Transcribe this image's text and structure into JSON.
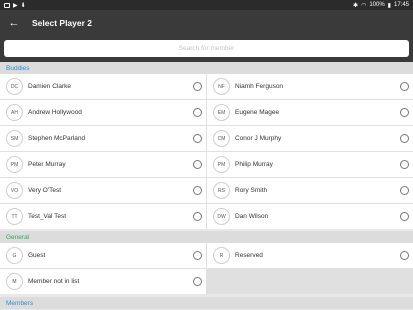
{
  "status_bar": {
    "battery": "100%",
    "time": "17:45"
  },
  "app_bar": {
    "title": "Select Player 2"
  },
  "search": {
    "placeholder": "Search for member"
  },
  "sections": {
    "buddies": "Buddies",
    "general": "General",
    "members": "Members"
  },
  "buddies": [
    {
      "initials": "DC",
      "name": "Damien Clarke"
    },
    {
      "initials": "NF",
      "name": "Niamh Ferguson"
    },
    {
      "initials": "AH",
      "name": "Andrew Hollywood"
    },
    {
      "initials": "EM",
      "name": "Eugene Magee"
    },
    {
      "initials": "SM",
      "name": "Stephen McParland"
    },
    {
      "initials": "CM",
      "name": "Conor J Murphy"
    },
    {
      "initials": "PM",
      "name": "Peter Murray"
    },
    {
      "initials": "PM",
      "name": "Philip Murray"
    },
    {
      "initials": "VO",
      "name": "Very O'Test"
    },
    {
      "initials": "RS",
      "name": "Rory Smith"
    },
    {
      "initials": "TT",
      "name": "Test_Val Test"
    },
    {
      "initials": "DW",
      "name": "Dan Wilson"
    }
  ],
  "general": [
    {
      "initials": "G",
      "name": "Guest"
    },
    {
      "initials": "R",
      "name": "Reserved"
    },
    {
      "initials": "M",
      "name": "Member not in list"
    }
  ]
}
